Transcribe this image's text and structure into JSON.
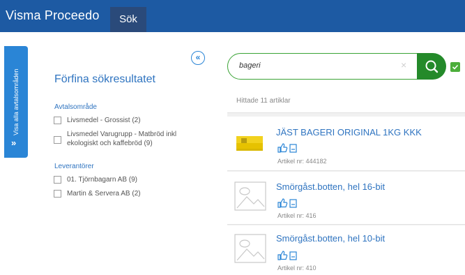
{
  "header": {
    "brand": "Visma Proceedo",
    "tab": "Sök"
  },
  "sidebar_toggle": {
    "label": "Visa alla avtalsområden",
    "arrow": "»"
  },
  "refine": {
    "collapse_glyph": "«",
    "title": "Förfina sökresultatet",
    "groups": [
      {
        "title": "Avtalsområde",
        "items": [
          {
            "label": "Livsmedel - Grossist (2)",
            "checked": false
          },
          {
            "label": "Livsmedel Varugrupp - Matbröd inkl ekologiskt och kaffebröd (9)",
            "checked": false
          }
        ]
      },
      {
        "title": "Leverantörer",
        "items": [
          {
            "label": "01. Tjörnbagarn AB (9)",
            "checked": false
          },
          {
            "label": "Martin & Servera AB (2)",
            "checked": false
          }
        ]
      }
    ]
  },
  "search": {
    "value": "bageri",
    "clear_glyph": "×"
  },
  "results_summary": "Hittade 11 artiklar",
  "results": [
    {
      "title": "JÄST BAGERI ORIGINAL 1KG KKK",
      "article": "Artikel nr: 444182",
      "thumb": "yeast-package"
    },
    {
      "title": "Smörgåst.botten, hel 16-bit",
      "article": "Artikel nr: 416",
      "thumb": "placeholder-image"
    },
    {
      "title": "Smörgåst.botten, hel 10-bit",
      "article": "Artikel nr: 410",
      "thumb": "placeholder-image"
    }
  ],
  "colors": {
    "header_bg": "#1d5aa3",
    "accent_blue": "#2f74c0",
    "search_green": "#248a2a"
  }
}
